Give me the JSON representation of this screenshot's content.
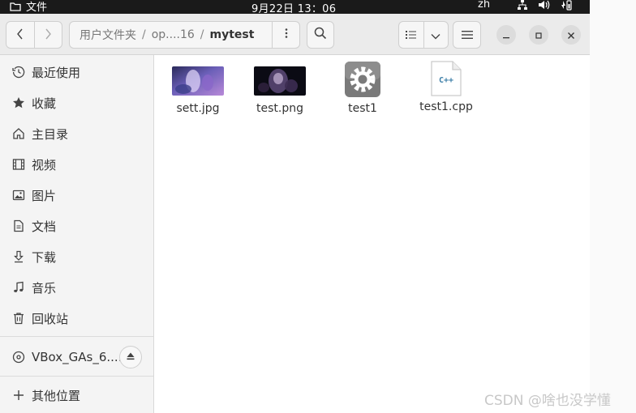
{
  "topbar": {
    "activities_label": "文件",
    "clock": "9月22日  13：06",
    "input_method": "zh"
  },
  "header": {
    "breadcrumbs": [
      "用户文件夹",
      "op....16",
      "mytest"
    ]
  },
  "sidebar": {
    "places": [
      {
        "label": "最近使用",
        "icon": "clock-icon"
      },
      {
        "label": "收藏",
        "icon": "star-icon"
      },
      {
        "label": "主目录",
        "icon": "home-icon"
      },
      {
        "label": "视频",
        "icon": "film-icon"
      },
      {
        "label": "图片",
        "icon": "image-icon"
      },
      {
        "label": "文档",
        "icon": "document-icon"
      },
      {
        "label": "下载",
        "icon": "download-icon"
      },
      {
        "label": "音乐",
        "icon": "music-icon"
      },
      {
        "label": "回收站",
        "icon": "trash-icon"
      }
    ],
    "device": {
      "label": "VBox_GAs_6....",
      "icon": "disc-icon"
    },
    "other_locations": {
      "label": "其他位置",
      "icon": "plus-icon"
    }
  },
  "files": [
    {
      "name": "sett.jpg",
      "type": "image-thumbnail"
    },
    {
      "name": "test.png",
      "type": "image-thumbnail"
    },
    {
      "name": "test1",
      "type": "executable-icon"
    },
    {
      "name": "test1.cpp",
      "type": "cpp-source-icon",
      "icon_text": "C++"
    }
  ],
  "watermark": "CSDN @啥也没学懂"
}
